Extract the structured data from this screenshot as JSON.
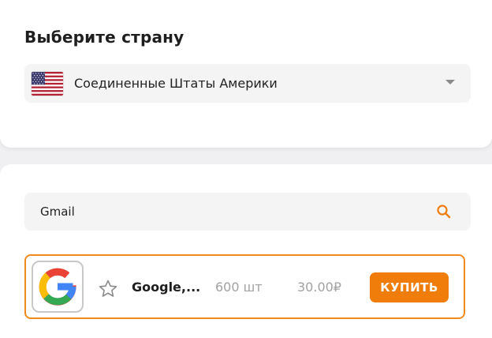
{
  "country_section": {
    "title": "Выберите страну",
    "selected_country": "Соединенные Штаты Америки",
    "flag_icon": "us-flag-icon"
  },
  "search": {
    "value": "Gmail",
    "icon": "search-icon",
    "icon_color": "#f07c0a"
  },
  "services": [
    {
      "name": "Google,...",
      "count": "600 шт",
      "price": "30.00₽",
      "buy_label": "КУПИТЬ",
      "logo_icon": "google-logo-icon",
      "favorite_icon": "star-icon"
    }
  ],
  "colors": {
    "accent": "#f07c0a",
    "row_border": "#f08a1c",
    "muted_text": "#a2a2a2"
  }
}
